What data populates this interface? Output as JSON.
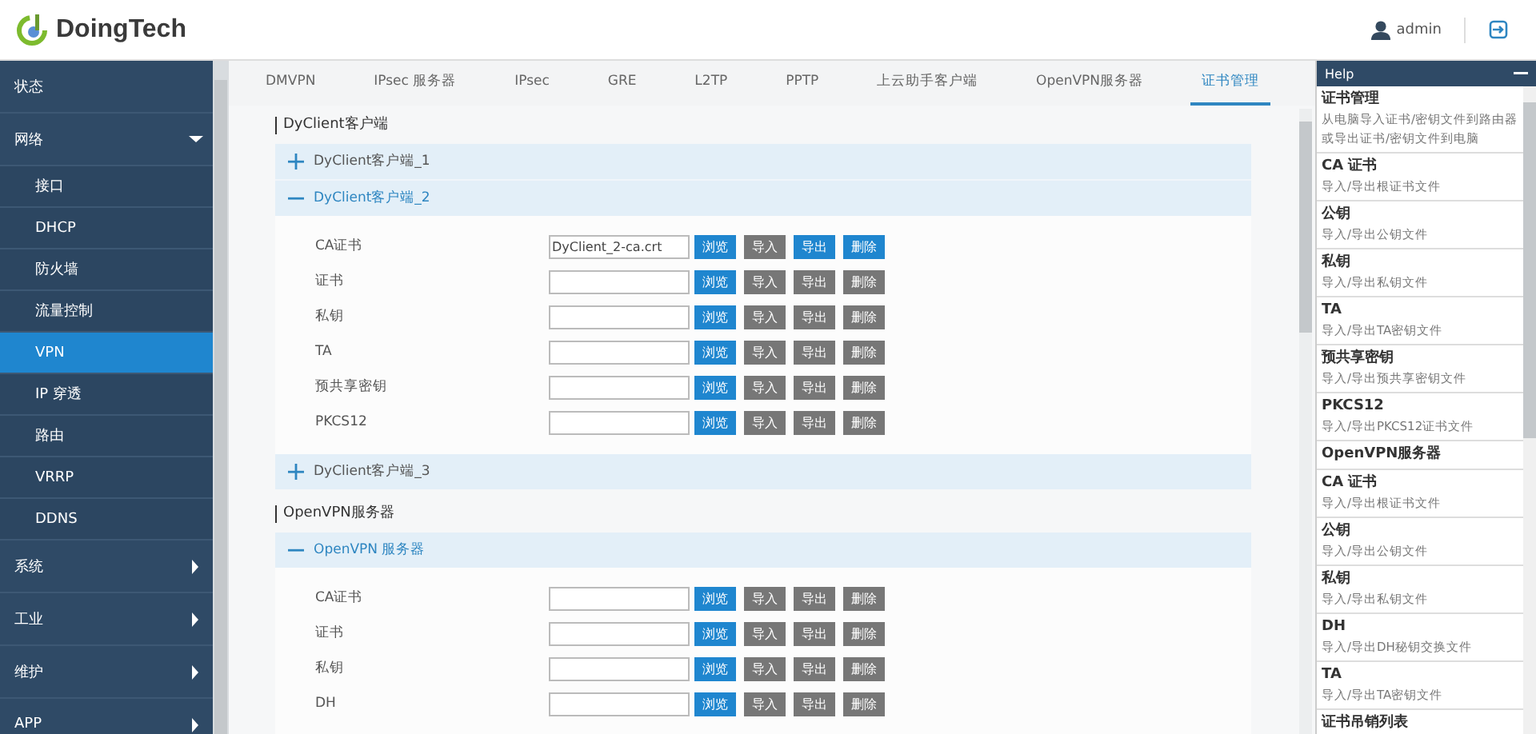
{
  "header": {
    "logo": "DoingTech",
    "user": "admin"
  },
  "sidebar": {
    "items": [
      {
        "label": "状态",
        "selected": false
      },
      {
        "label": "网络",
        "selected": false,
        "expanded": true,
        "children": [
          {
            "label": "接口",
            "selected": false
          },
          {
            "label": "DHCP",
            "selected": false
          },
          {
            "label": "防火墙",
            "selected": false
          },
          {
            "label": "流量控制",
            "selected": false
          },
          {
            "label": "VPN",
            "selected": true
          },
          {
            "label": "IP 穿透",
            "selected": false
          },
          {
            "label": "路由",
            "selected": false
          },
          {
            "label": "VRRP",
            "selected": false
          },
          {
            "label": "DDNS",
            "selected": false
          }
        ]
      },
      {
        "label": "系统",
        "selected": false,
        "expanded": false
      },
      {
        "label": "工业",
        "selected": false,
        "expanded": false
      },
      {
        "label": "维护",
        "selected": false,
        "expanded": false
      },
      {
        "label": "APP",
        "selected": false,
        "expanded": false
      }
    ]
  },
  "tabs": [
    {
      "label": "DMVPN",
      "selected": false
    },
    {
      "label": "IPsec 服务器",
      "selected": false
    },
    {
      "label": "IPsec",
      "selected": false
    },
    {
      "label": "GRE",
      "selected": false
    },
    {
      "label": "L2TP",
      "selected": false
    },
    {
      "label": "PPTP",
      "selected": false
    },
    {
      "label": "上云助手客户端",
      "selected": false
    },
    {
      "label": "OpenVPN服务器",
      "selected": false
    },
    {
      "label": "证书管理",
      "selected": true
    }
  ],
  "sections": [
    {
      "title": "DyClient客户端",
      "groups": [
        {
          "label": "DyClient客户端_1",
          "expanded": false
        },
        {
          "label": "DyClient客户端_2",
          "expanded": true,
          "rows": [
            {
              "label": "CA证书",
              "value": "DyClient_2-ca.crt",
              "buttons": [
                {
                  "label": "浏览",
                  "enabled": true
                },
                {
                  "label": "导入",
                  "enabled": false
                },
                {
                  "label": "导出",
                  "enabled": true
                },
                {
                  "label": "删除",
                  "enabled": true
                }
              ]
            },
            {
              "label": "证书",
              "buttons": [
                {
                  "label": "浏览",
                  "enabled": true
                },
                {
                  "label": "导入",
                  "enabled": false
                },
                {
                  "label": "导出",
                  "enabled": false
                },
                {
                  "label": "删除",
                  "enabled": false
                }
              ]
            },
            {
              "label": "私钥",
              "buttons": [
                {
                  "label": "浏览",
                  "enabled": true
                },
                {
                  "label": "导入",
                  "enabled": false
                },
                {
                  "label": "导出",
                  "enabled": false
                },
                {
                  "label": "删除",
                  "enabled": false
                }
              ]
            },
            {
              "label": "TA",
              "buttons": [
                {
                  "label": "浏览",
                  "enabled": true
                },
                {
                  "label": "导入",
                  "enabled": false
                },
                {
                  "label": "导出",
                  "enabled": false
                },
                {
                  "label": "删除",
                  "enabled": false
                }
              ]
            },
            {
              "label": "预共享密钥",
              "buttons": [
                {
                  "label": "浏览",
                  "enabled": true
                },
                {
                  "label": "导入",
                  "enabled": false
                },
                {
                  "label": "导出",
                  "enabled": false
                },
                {
                  "label": "删除",
                  "enabled": false
                }
              ]
            },
            {
              "label": "PKCS12",
              "buttons": [
                {
                  "label": "浏览",
                  "enabled": true
                },
                {
                  "label": "导入",
                  "enabled": false
                },
                {
                  "label": "导出",
                  "enabled": false
                },
                {
                  "label": "删除",
                  "enabled": false
                }
              ]
            }
          ]
        },
        {
          "label": "DyClient客户端_3",
          "expanded": false
        }
      ]
    },
    {
      "title": "OpenVPN服务器",
      "groups": [
        {
          "label": "OpenVPN 服务器",
          "expanded": true,
          "rows": [
            {
              "label": "CA证书",
              "buttons": [
                {
                  "label": "浏览",
                  "enabled": true
                },
                {
                  "label": "导入",
                  "enabled": false
                },
                {
                  "label": "导出",
                  "enabled": false
                },
                {
                  "label": "删除",
                  "enabled": false
                }
              ]
            },
            {
              "label": "证书",
              "buttons": [
                {
                  "label": "浏览",
                  "enabled": true
                },
                {
                  "label": "导入",
                  "enabled": false
                },
                {
                  "label": "导出",
                  "enabled": false
                },
                {
                  "label": "删除",
                  "enabled": false
                }
              ]
            },
            {
              "label": "私钥",
              "buttons": [
                {
                  "label": "浏览",
                  "enabled": true
                },
                {
                  "label": "导入",
                  "enabled": false
                },
                {
                  "label": "导出",
                  "enabled": false
                },
                {
                  "label": "删除",
                  "enabled": false
                }
              ]
            },
            {
              "label": "DH",
              "buttons": [
                {
                  "label": "浏览",
                  "enabled": true
                },
                {
                  "label": "导入",
                  "enabled": false
                },
                {
                  "label": "导出",
                  "enabled": false
                },
                {
                  "label": "删除",
                  "enabled": false
                }
              ]
            }
          ]
        }
      ]
    }
  ],
  "help": {
    "title": "Help",
    "items": [
      {
        "title": "证书管理",
        "description": "从电脑导入证书/密钥文件到路由器或导出证书/密钥文件到电脑"
      },
      {
        "title": "CA 证书",
        "description": "导入/导出根证书文件"
      },
      {
        "title": "公钥",
        "description": "导入/导出公钥文件"
      },
      {
        "title": "私钥",
        "description": "导入/导出私钥文件"
      },
      {
        "title": "TA",
        "description": "导入/导出TA密钥文件"
      },
      {
        "title": "预共享密钥",
        "description": "导入/导出预共享密钥文件"
      },
      {
        "title": "PKCS12",
        "description": "导入/导出PKCS12证书文件"
      },
      {
        "title": "OpenVPN服务器"
      },
      {
        "title": "CA 证书",
        "description": "导入/导出根证书文件"
      },
      {
        "title": "公钥",
        "description": "导入/导出公钥文件"
      },
      {
        "title": "私钥",
        "description": "导入/导出私钥文件"
      },
      {
        "title": "DH",
        "description": "导入/导出DH秘钥交换文件"
      },
      {
        "title": "TA",
        "description": "导入/导出TA密钥文件"
      },
      {
        "title": "证书吊销列表"
      }
    ]
  }
}
